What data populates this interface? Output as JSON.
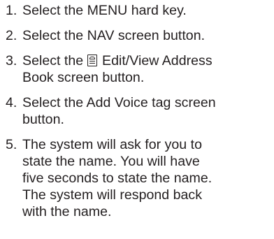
{
  "steps": [
    {
      "num": "1.",
      "lines": [
        "Select the MENU hard key."
      ]
    },
    {
      "num": "2.",
      "lines": [
        "Select the NAV screen button."
      ]
    },
    {
      "num": "3.",
      "before_icon": "Select the ",
      "icon": "address-book-icon",
      "lines": [
        "Edit/View Address",
        "Book screen button."
      ]
    },
    {
      "num": "4.",
      "lines": [
        "Select the Add Voice tag screen",
        "button."
      ]
    },
    {
      "num": "5.",
      "lines": [
        "The system will ask for you to",
        "state the name. You will have",
        "five seconds to state the name.",
        "The system will respond back",
        "with the name."
      ]
    }
  ]
}
